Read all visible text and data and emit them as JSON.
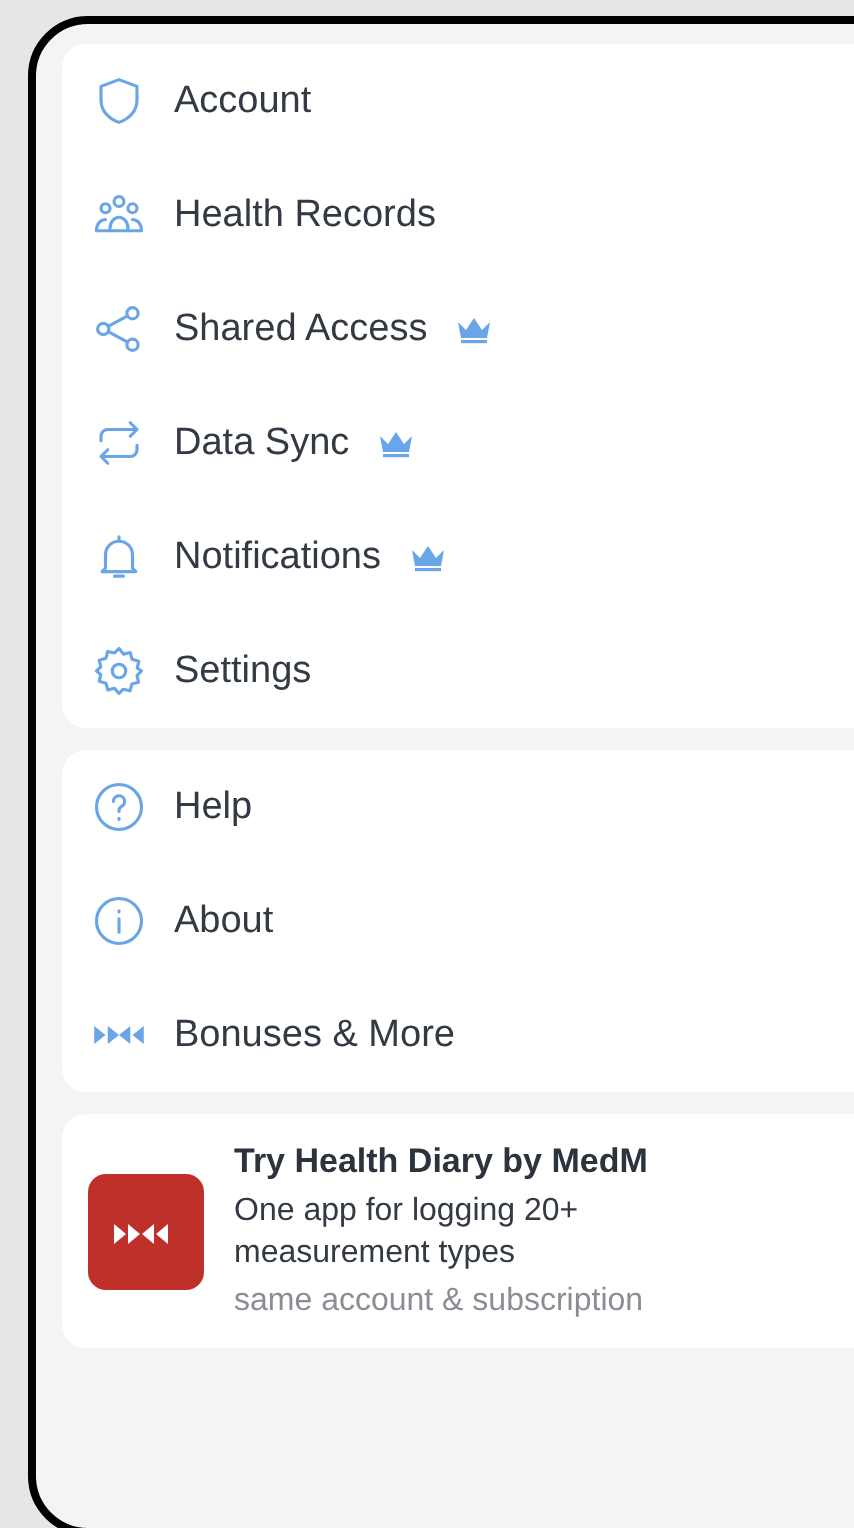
{
  "menu_groups": [
    {
      "items": [
        {
          "label": "Account",
          "premium": false
        },
        {
          "label": "Health Records",
          "premium": false
        },
        {
          "label": "Shared Access",
          "premium": true
        },
        {
          "label": "Data Sync",
          "premium": true
        },
        {
          "label": "Notifications",
          "premium": true
        },
        {
          "label": "Settings",
          "premium": false
        }
      ]
    },
    {
      "items": [
        {
          "label": "Help",
          "premium": false
        },
        {
          "label": "About",
          "premium": false
        },
        {
          "label": "Bonuses & More",
          "premium": false
        }
      ]
    }
  ],
  "promo": {
    "title": "Try Health Diary by MedM",
    "description": "One app for logging 20+ measurement types",
    "note": "same account & subscription"
  }
}
